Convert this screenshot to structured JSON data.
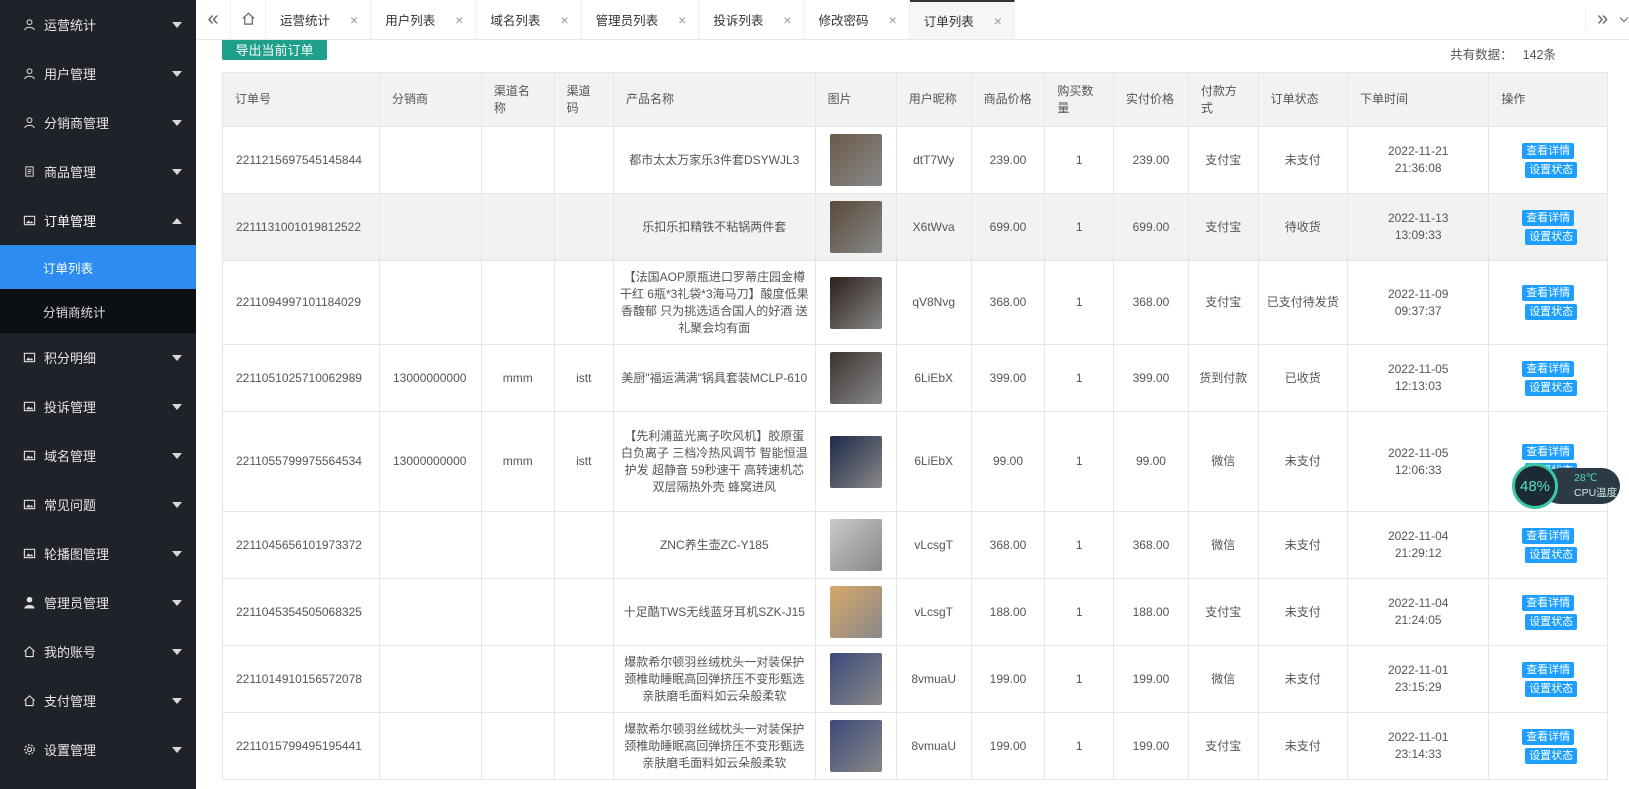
{
  "sidebar": {
    "items": [
      {
        "label": "运营统计",
        "icon": "user-icon"
      },
      {
        "label": "用户管理",
        "icon": "user-icon"
      },
      {
        "label": "分销商管理",
        "icon": "user-icon"
      },
      {
        "label": "商品管理",
        "icon": "file-icon"
      },
      {
        "label": "订单管理",
        "icon": "image-icon",
        "open": true,
        "children": [
          {
            "label": "订单列表",
            "active": true
          },
          {
            "label": "分销商统计"
          }
        ]
      },
      {
        "label": "积分明细",
        "icon": "image-icon"
      },
      {
        "label": "投诉管理",
        "icon": "image-icon"
      },
      {
        "label": "域名管理",
        "icon": "image-icon"
      },
      {
        "label": "常见问题",
        "icon": "image-icon"
      },
      {
        "label": "轮播图管理",
        "icon": "image-icon"
      },
      {
        "label": "管理员管理",
        "icon": "person-icon"
      },
      {
        "label": "我的账号",
        "icon": "home-icon"
      },
      {
        "label": "支付管理",
        "icon": "home-icon"
      },
      {
        "label": "设置管理",
        "icon": "gear-icon"
      }
    ]
  },
  "tabs": {
    "left_nav": "«",
    "right_nav": "»",
    "items": [
      {
        "label": "运营统计"
      },
      {
        "label": "用户列表"
      },
      {
        "label": "域名列表"
      },
      {
        "label": "管理员列表"
      },
      {
        "label": "投诉列表"
      },
      {
        "label": "修改密码"
      },
      {
        "label": "订单列表",
        "active": true
      }
    ]
  },
  "toolbar": {
    "export_label": "导出当前订单",
    "total_label": "共有数据：",
    "total_value": "142条"
  },
  "table": {
    "headers": [
      "订单号",
      "分销商",
      "渠道名称",
      "渠道码",
      "产品名称",
      "图片",
      "用户昵称",
      "商品价格",
      "购买数量",
      "实付价格",
      "付款方式",
      "订单状态",
      "下单时间",
      "操作"
    ],
    "op_detail": "查看详情",
    "op_status": "设置状态",
    "rows": [
      {
        "order_no": "2211215697545145844",
        "distributor": "",
        "channel_name": "",
        "channel_code": "",
        "product": "都市太太万家乐3件套DSYWJL3",
        "nickname": "dtT7Wy",
        "price": "239.00",
        "qty": "1",
        "paid": "239.00",
        "pay_method": "支付宝",
        "status": "未支付",
        "date": "2022-11-21",
        "time": "21:36:08",
        "img_color": "#6b5a4a"
      },
      {
        "order_no": "2211131001019812522",
        "distributor": "",
        "channel_name": "",
        "channel_code": "",
        "product": "乐扣乐扣精铁不粘锅两件套",
        "nickname": "X6tWva",
        "price": "699.00",
        "qty": "1",
        "paid": "699.00",
        "pay_method": "支付宝",
        "status": "待收货",
        "date": "2022-11-13",
        "time": "13:09:33",
        "img_color": "#5a4a3a"
      },
      {
        "order_no": "2211094997101184029",
        "distributor": "",
        "channel_name": "",
        "channel_code": "",
        "product": "【法国AOP原瓶进口罗蒂庄园金樽干红 6瓶*3礼袋*3海马刀】酸度低果香馥郁 只为挑选适合国人的好酒 送礼聚会均有面",
        "nickname": "qV8Nvg",
        "price": "368.00",
        "qty": "1",
        "paid": "368.00",
        "pay_method": "支付宝",
        "status": "已支付待发货",
        "date": "2022-11-09",
        "time": "09:37:37",
        "img_color": "#2c1f1a"
      },
      {
        "order_no": "2211051025710062989",
        "distributor": "13000000000",
        "channel_name": "mmm",
        "channel_code": "istt",
        "product": "美厨\"福运满满\"锅具套装MCLP-610",
        "nickname": "6LiEbX",
        "price": "399.00",
        "qty": "1",
        "paid": "399.00",
        "pay_method": "货到付款",
        "status": "已收货",
        "date": "2022-11-05",
        "time": "12:13:03",
        "img_color": "#3a3330"
      },
      {
        "order_no": "2211055799975564534",
        "distributor": "13000000000",
        "channel_name": "mmm",
        "channel_code": "istt",
        "product": "【先利浦蓝光离子吹风机】胶原蛋白负离子 三档冷热风调节 智能恒温护发 超静音 59秒速干 高转速机芯 双层隔热外壳 蜂窝进风",
        "nickname": "6LiEbX",
        "price": "99.00",
        "qty": "1",
        "paid": "99.00",
        "pay_method": "微信",
        "status": "未支付",
        "date": "2022-11-05",
        "time": "12:06:33",
        "img_color": "#1f2a4a"
      },
      {
        "order_no": "2211045656101973372",
        "distributor": "",
        "channel_name": "",
        "channel_code": "",
        "product": "ZNC养生壶ZC-Y185",
        "nickname": "vLcsgT",
        "price": "368.00",
        "qty": "1",
        "paid": "368.00",
        "pay_method": "微信",
        "status": "未支付",
        "date": "2022-11-04",
        "time": "21:29:12",
        "img_color": "#c9c9c9"
      },
      {
        "order_no": "2211045354505068325",
        "distributor": "",
        "channel_name": "",
        "channel_code": "",
        "product": "十足酷TWS无线蓝牙耳机SZK-J15",
        "nickname": "vLcsgT",
        "price": "188.00",
        "qty": "1",
        "paid": "188.00",
        "pay_method": "支付宝",
        "status": "未支付",
        "date": "2022-11-04",
        "time": "21:24:05",
        "img_color": "#d9a86a"
      },
      {
        "order_no": "2211014910156572078",
        "distributor": "",
        "channel_name": "",
        "channel_code": "",
        "product": "爆款希尔顿羽丝绒枕头一对装保护颈椎助睡眠高回弹挤压不变形甄选亲肤磨毛面料如云朵般柔软",
        "nickname": "8vmuaU",
        "price": "199.00",
        "qty": "1",
        "paid": "199.00",
        "pay_method": "微信",
        "status": "未支付",
        "date": "2022-11-01",
        "time": "23:15:29",
        "img_color": "#3c4a7a"
      },
      {
        "order_no": "2211015799495195441",
        "distributor": "",
        "channel_name": "",
        "channel_code": "",
        "product": "爆款希尔顿羽丝绒枕头一对装保护颈椎助睡眠高回弹挤压不变形甄选亲肤磨毛面料如云朵般柔软",
        "nickname": "8vmuaU",
        "price": "199.00",
        "qty": "1",
        "paid": "199.00",
        "pay_method": "支付宝",
        "status": "未支付",
        "date": "2022-11-01",
        "time": "23:14:33",
        "img_color": "#3c4a7a"
      }
    ]
  },
  "cpu_widget": {
    "percent": "48%",
    "temp": "28℃",
    "label": "CPU温度"
  }
}
